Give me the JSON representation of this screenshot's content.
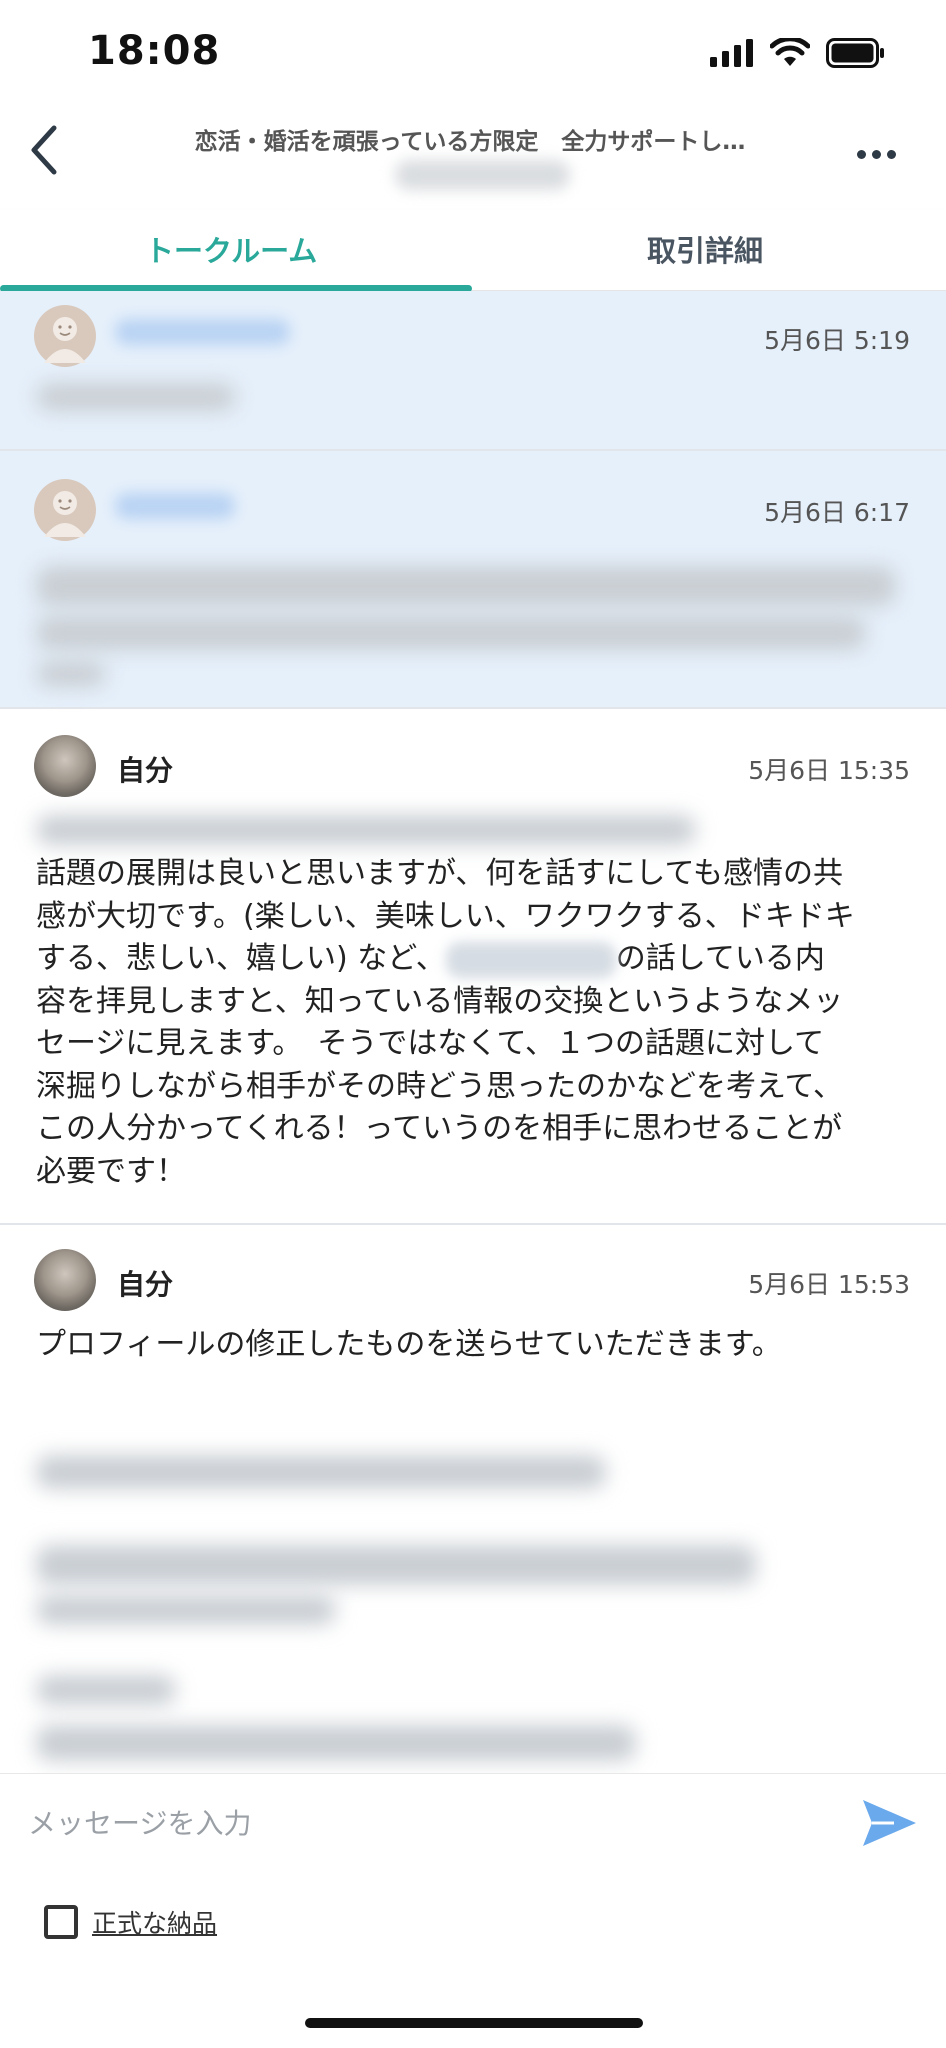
{
  "status_bar": {
    "time": "18:08"
  },
  "header": {
    "title": "恋活・婚活を頑張っている方限定　全力サポートし…"
  },
  "tabs": [
    {
      "label": "トークルーム",
      "active": true
    },
    {
      "label": "取引詳細",
      "active": false
    }
  ],
  "messages": [
    {
      "timestamp": "5月6日 5:19"
    },
    {
      "timestamp": "5月6日 6:17"
    },
    {
      "sender": "自分",
      "timestamp": "5月6日 15:35",
      "text_before": "話題の展開は良いと思いますが、何を話すにしても感情の共\n感が大切です。(楽しい、美味しい、ワクワクする、ドキドキ\nする、悲しい、嬉しい) など、",
      "text_after": "の話している内\n容を拝見しますと、知っている情報の交換というようなメッ\nセージに見えます。　そうではなくて、１つの話題に対して\n深掘りしながら相手がその時どう思ったのかなどを考えて、\nこの人分かってくれる！っていうのを相手に思わせることが\n必要です！"
    },
    {
      "sender": "自分",
      "timestamp": "5月6日 15:53",
      "text": "プロフィールの修正したものを送らせていただきます。"
    }
  ],
  "input": {
    "placeholder": "メッセージを入力"
  },
  "checkbox": {
    "label": "正式な納品",
    "checked": false
  },
  "colors": {
    "accent": "#2aa99b",
    "received_bg": "#e6f0fb",
    "send_icon": "#6aa9ec"
  },
  "icons": [
    "back-chevron-icon",
    "more-dots-icon",
    "send-icon",
    "signal-icon",
    "wifi-icon",
    "battery-icon"
  ]
}
